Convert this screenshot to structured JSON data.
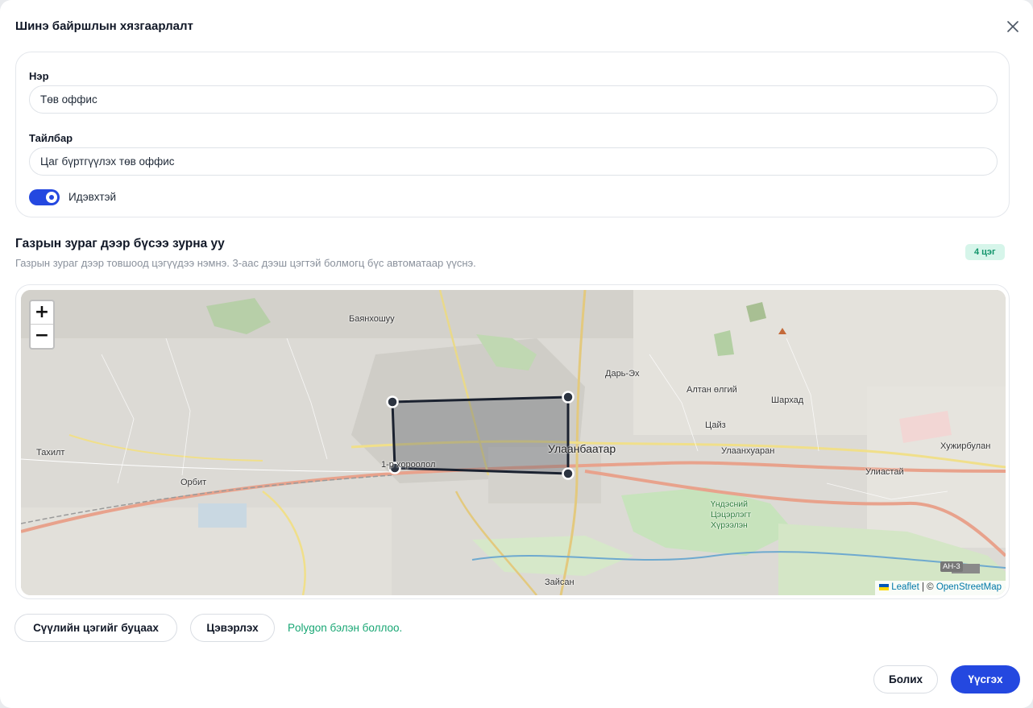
{
  "dialog": {
    "title": "Шинэ байршлын хязгаарлалт"
  },
  "form": {
    "name_label": "Нэр",
    "name_value": "Төв оффис",
    "description_label": "Тайлбар",
    "description_value": "Цаг бүртгүүлэх төв оффис",
    "active_label": "Идэвхтэй",
    "active": true
  },
  "map_section": {
    "title": "Газрын зураг дээр бүсээ зурна уу",
    "description": "Газрын зураг дээр товшоод цэгүүдээ нэмнэ. 3-аас дээш цэгтэй болмогц бүс автоматаар үүснэ.",
    "point_count_badge": "4 цэг",
    "zoom_in": "+",
    "zoom_out": "−",
    "attribution_leaflet": "Leaflet",
    "attribution_separator": " | © ",
    "attribution_osm": "OpenStreetMap",
    "accent_colors": {
      "polygon_stroke": "#1b2230",
      "vertex_fill": "#2b3340",
      "primary": "#2448e0",
      "success": "#17a673"
    },
    "places": {
      "bayankhoshuu": "Баянхошуу",
      "ulaanbaatar": "Улаанбаатар",
      "dari_ekh": "Дарь-Эх",
      "altan_olgii": "Алтан өлгий",
      "sharkhad": "Шархад",
      "tsaiz": "Цайз",
      "ulaankhuaran": "Улаанхуаран",
      "khuzhirbulan": "Хужирбулан",
      "uliastai": "Улиастай",
      "takhilt": "Тахилт",
      "orbit": "Орбит",
      "district_1": "1-р хороолол",
      "national_park": "Үндэсний Цэцэрлэгт Хүрээлэн",
      "zaisan": "Зайсан",
      "road_ah3": "AH-3"
    }
  },
  "actions": {
    "undo_label": "Сүүлийн цэгийг буцаах",
    "clear_label": "Цэвэрлэх",
    "status": "Polygon бэлэн боллоо.",
    "cancel_label": "Болих",
    "create_label": "Үүсгэх"
  }
}
